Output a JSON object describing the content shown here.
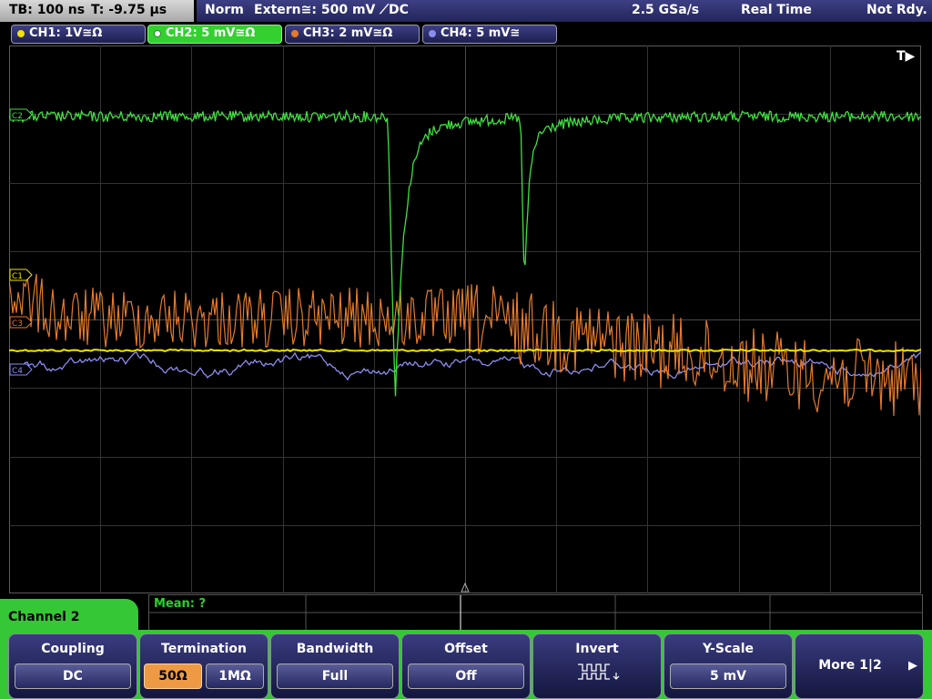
{
  "topbar": {
    "timebase": "TB: 100 ns",
    "trigger_time": "T: -9.75 µs",
    "mode": "Norm",
    "trigger_source": "Extern≅: 500 mV ⟋DC",
    "sample_rate": "2.5 GSa/s",
    "acq_mode": "Real Time",
    "status": "Not Rdy."
  },
  "channels": [
    {
      "label": "CH1: 1V≅Ω",
      "color": "#f2e000"
    },
    {
      "label": "CH2: 5 mV≅Ω",
      "color": "#38d838"
    },
    {
      "label": "CH3: 2 mV≅Ω",
      "color": "#e57a2c"
    },
    {
      "label": "CH4: 5 mV≅",
      "color": "#8c8cf0"
    }
  ],
  "markers": {
    "trigger": "T▶",
    "ch1": "C1",
    "ch2": "C2",
    "ch3": "C3",
    "ch4": "C4"
  },
  "measurement": {
    "mean": "Mean: ?"
  },
  "menu": {
    "title": "Channel 2",
    "coupling": {
      "title": "Coupling",
      "value": "DC"
    },
    "termination": {
      "title": "Termination",
      "opt1": "50Ω",
      "opt2": "1MΩ",
      "selected": "50Ω"
    },
    "bandwidth": {
      "title": "Bandwidth",
      "value": "Full"
    },
    "offset": {
      "title": "Offset",
      "value": "Off"
    },
    "invert": {
      "title": "Invert",
      "icon": "inverted-square-wave-icon"
    },
    "yscale": {
      "title": "Y-Scale",
      "value": "5 mV"
    },
    "more": {
      "label": "More 1|2",
      "icon": "right-arrow-icon"
    }
  }
}
